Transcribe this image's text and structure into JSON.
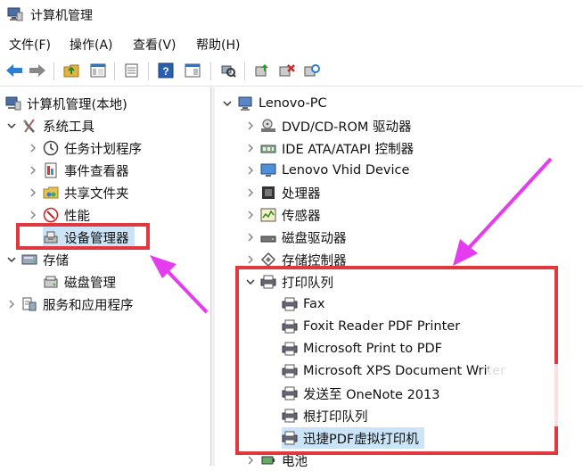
{
  "window": {
    "title": "计算机管理"
  },
  "menu": [
    {
      "label": "文件(F)"
    },
    {
      "label": "操作(A)"
    },
    {
      "label": "查看(V)"
    },
    {
      "label": "帮助(H)"
    }
  ],
  "left_tree": {
    "root": "计算机管理(本地)",
    "system_tools": "系统工具",
    "task_scheduler": "任务计划程序",
    "event_viewer": "事件查看器",
    "shared_folders": "共享文件夹",
    "performance": "性能",
    "device_manager": "设备管理器",
    "storage": "存储",
    "disk_management": "磁盘管理",
    "services_apps": "服务和应用程序"
  },
  "right_tree": {
    "computer": "Lenovo-PC",
    "categories": [
      "DVD/CD-ROM 驱动器",
      "IDE ATA/ATAPI 控制器",
      "Lenovo Vhid Device",
      "处理器",
      "传感器",
      "磁盘驱动器",
      "存储控制器"
    ],
    "print_queue": "打印队列",
    "printers": [
      "Fax",
      "Foxit Reader PDF Printer",
      "Microsoft Print to PDF",
      "Microsoft XPS Document Writer",
      "发送至 OneNote 2013",
      "根打印队列",
      "迅捷PDF虚拟打印机"
    ],
    "battery": "电池"
  },
  "colors": {
    "accent_red": "#e0383e",
    "arrow_magenta": "#e63cf0",
    "selection": "#cce4f7"
  }
}
